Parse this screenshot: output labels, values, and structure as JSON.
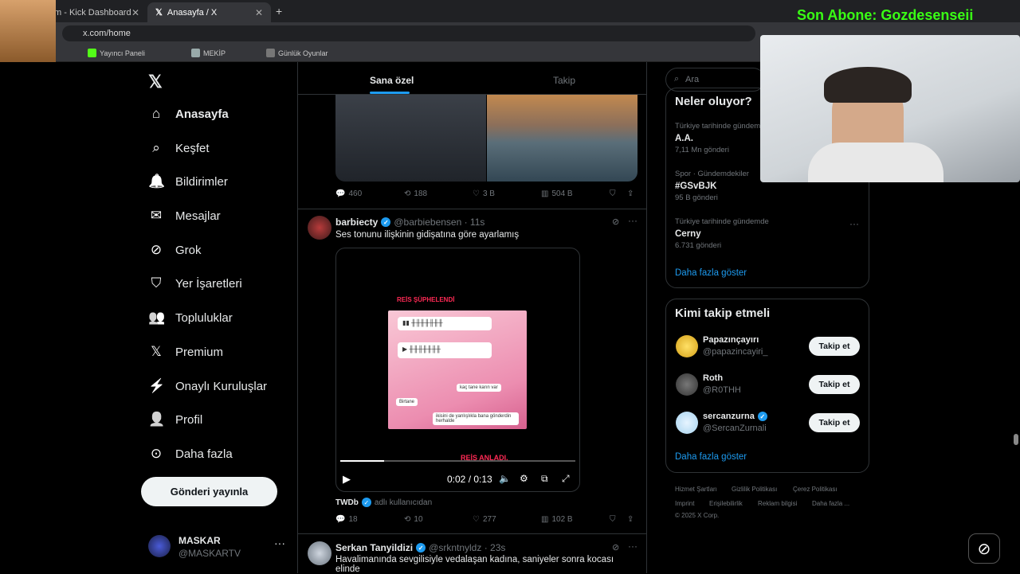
{
  "browser": {
    "tabs": [
      {
        "title": "m - Kick Dashboard"
      },
      {
        "title": "Anasayfa / X"
      }
    ],
    "url": "x.com/home",
    "bookmarks": [
      "Yayıncı Paneli",
      "MEKİP",
      "Günlük Oyunlar"
    ]
  },
  "overlay": {
    "banner": "Son Abone: Gozdesenseii"
  },
  "nav": {
    "items": [
      {
        "label": "Anasayfa",
        "icon": "home-icon"
      },
      {
        "label": "Keşfet",
        "icon": "search-icon"
      },
      {
        "label": "Bildirimler",
        "icon": "bell-icon"
      },
      {
        "label": "Mesajlar",
        "icon": "mail-icon"
      },
      {
        "label": "Grok",
        "icon": "grok-icon"
      },
      {
        "label": "Yer İşaretleri",
        "icon": "bookmark-icon"
      },
      {
        "label": "Topluluklar",
        "icon": "communities-icon"
      },
      {
        "label": "Premium",
        "icon": "x-icon"
      },
      {
        "label": "Onaylı Kuruluşlar",
        "icon": "lightning-icon"
      },
      {
        "label": "Profil",
        "icon": "person-icon"
      },
      {
        "label": "Daha fazla",
        "icon": "more-circle-icon"
      }
    ],
    "post_button": "Gönderi yayınla",
    "profile": {
      "name": "MASKAR",
      "handle": "@MASKARTV"
    }
  },
  "feed": {
    "tabs": [
      "Sana özel",
      "Takip"
    ],
    "tweet1_stats": {
      "replies": "460",
      "reposts": "188",
      "likes": "3 B",
      "views": "504 B"
    },
    "tweet2": {
      "name": "barbiecty",
      "handle": "@barbiebensen · 11s",
      "text": "Ses tonunu ilişkinin gidişatına göre ayarlamış",
      "video_top_text": "REİS ŞÜPHELENDİ",
      "video_bottom_text": "REİS ANLADI.",
      "video_time": "0:02 / 0:13",
      "chat_lines": [
        "Birtane",
        "kaç tane karın var",
        "ikisini de yanlışlıkla bana gönderdin herhalde"
      ],
      "source_name": "TWDb",
      "source_suffix": "adlı kullanıcıdan",
      "stats": {
        "replies": "18",
        "reposts": "10",
        "likes": "277",
        "views": "102 B"
      }
    },
    "tweet3": {
      "name": "Serkan Tanyildizi",
      "handle": "@srkntnyldz · 23s",
      "text": "Havalimanında sevgilisiyle vedalaşan kadına, saniyeler sonra kocası elinde"
    }
  },
  "right": {
    "search_placeholder": "Ara",
    "trends_title": "Neler oluyor?",
    "trends": [
      {
        "meta": "Türkiye tarihinde gündem",
        "name": "A.A.",
        "count": "7,11 Mn gönderi"
      },
      {
        "meta": "Spor · Gündemdekiler",
        "name": "#GSvBJK",
        "count": "95 B gönderi"
      },
      {
        "meta": "Türkiye tarihinde gündemde",
        "name": "Cerny",
        "count": "6.731 gönderi"
      }
    ],
    "show_more": "Daha fazla göster",
    "who_title": "Kimi takip etmeli",
    "who": [
      {
        "name": "Papazınçayırı",
        "handle": "@papazincayiri_",
        "verified": false
      },
      {
        "name": "Roth",
        "handle": "@R0THH",
        "verified": false
      },
      {
        "name": "sercanzurna",
        "handle": "@SercanZurnali",
        "verified": true
      }
    ],
    "follow_label": "Takip et",
    "footer": [
      "Hizmet Şartları",
      "Gizlilik Politikası",
      "Çerez Politikası",
      "Imprint",
      "Erişilebilirlik",
      "Reklam bilgisi",
      "Daha fazla ...",
      "© 2025 X Corp."
    ]
  }
}
